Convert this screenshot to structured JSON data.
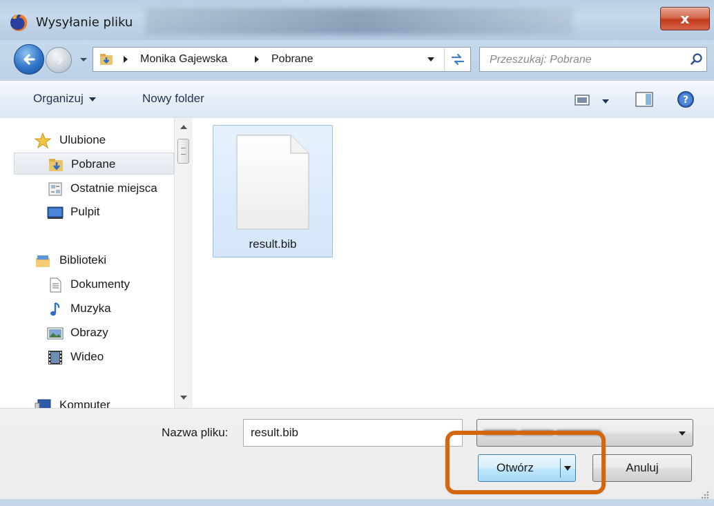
{
  "window": {
    "title": "Wysyłanie pliku",
    "close_label": "x"
  },
  "address": {
    "crumbs": [
      "Monika Gajewska",
      "Pobrane"
    ]
  },
  "search": {
    "placeholder": "Przeszukaj: Pobrane"
  },
  "toolbar": {
    "organize_label": "Organizuj",
    "new_folder_label": "Nowy folder"
  },
  "sidebar": {
    "items": [
      {
        "label": "Ulubione",
        "icon": "star-icon"
      },
      {
        "label": "Pobrane",
        "icon": "downloads-folder-icon"
      },
      {
        "label": "Ostatnie miejsca",
        "icon": "recent-places-icon"
      },
      {
        "label": "Pulpit",
        "icon": "desktop-icon"
      },
      {
        "label": "Biblioteki",
        "icon": "libraries-icon"
      },
      {
        "label": "Dokumenty",
        "icon": "documents-icon"
      },
      {
        "label": "Muzyka",
        "icon": "music-icon"
      },
      {
        "label": "Obrazy",
        "icon": "pictures-icon"
      },
      {
        "label": "Wideo",
        "icon": "video-icon"
      },
      {
        "label": "Komputer",
        "icon": "computer-icon"
      }
    ],
    "selected": "Pobrane"
  },
  "files": [
    {
      "name": "result.bib",
      "icon": "file-icon"
    }
  ],
  "footer": {
    "filename_label": "Nazwa pliku:",
    "filename_value": "result.bib",
    "open_label": "Otwórz",
    "cancel_label": "Anuluj"
  },
  "colors": {
    "highlight": "#d4660e",
    "accent": "#3c7fb1"
  }
}
